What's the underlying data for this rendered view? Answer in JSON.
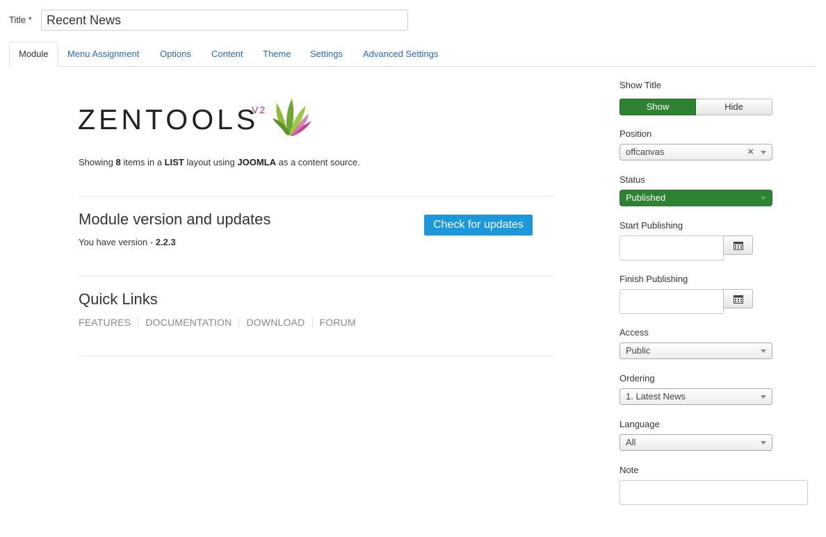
{
  "title_field": {
    "label": "Title *",
    "value": "Recent News"
  },
  "tabs": [
    {
      "label": "Module",
      "active": true
    },
    {
      "label": "Menu Assignment"
    },
    {
      "label": "Options"
    },
    {
      "label": "Content"
    },
    {
      "label": "Theme"
    },
    {
      "label": "Settings"
    },
    {
      "label": "Advanced Settings"
    }
  ],
  "logo": {
    "text": "ZENTOOLS",
    "version": "V2"
  },
  "summary": {
    "prefix": "Showing ",
    "count": "8",
    "mid1": " items in a ",
    "layout": "LIST",
    "mid2": " layout using ",
    "source": "JOOMLA",
    "suffix": " as a content source."
  },
  "updates": {
    "heading": "Module version and updates",
    "version_prefix": "You have version - ",
    "version": "2.2.3",
    "button_label": "Check for updates",
    "button_color": "#1b97db"
  },
  "quick_links": {
    "heading": "Quick Links",
    "links": [
      "FEATURES",
      "DOCUMENTATION",
      "DOWNLOAD",
      "FORUM"
    ]
  },
  "sidebar": {
    "show_title": {
      "label": "Show Title",
      "options": [
        "Show",
        "Hide"
      ],
      "selected": "Show"
    },
    "position": {
      "label": "Position",
      "value": "offcanvas",
      "clear_icon": "close-icon"
    },
    "status": {
      "label": "Status",
      "value": "Published",
      "color": "#2d8332"
    },
    "start_publishing": {
      "label": "Start Publishing",
      "value": "",
      "icon": "calendar-icon"
    },
    "finish_publishing": {
      "label": "Finish Publishing",
      "value": "",
      "icon": "calendar-icon"
    },
    "access": {
      "label": "Access",
      "value": "Public"
    },
    "ordering": {
      "label": "Ordering",
      "value": "1. Latest News"
    },
    "language": {
      "label": "Language",
      "value": "All"
    },
    "note": {
      "label": "Note",
      "value": ""
    }
  },
  "colors": {
    "link": "#2a69b8",
    "accent_green": "#2d8332",
    "brand_magenta": "#b52a7b"
  }
}
